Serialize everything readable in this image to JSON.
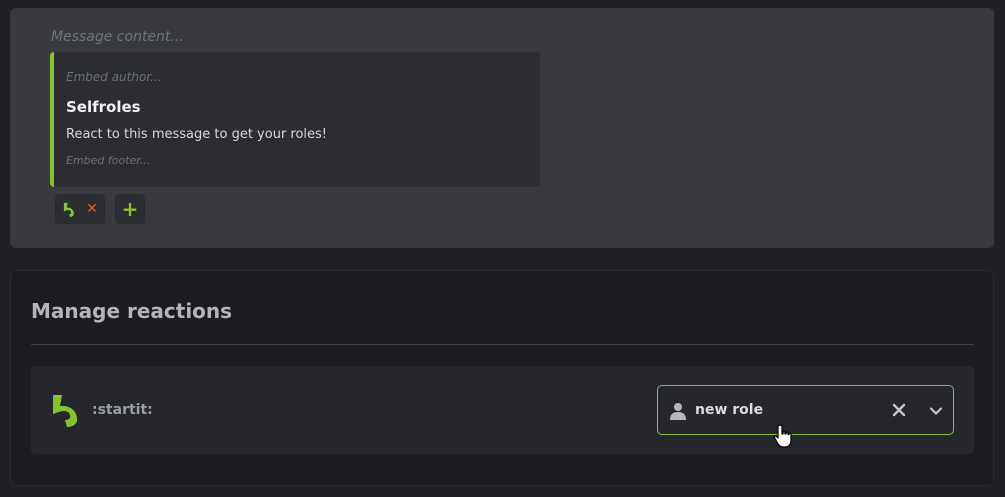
{
  "message": {
    "content_placeholder": "Message content...",
    "embed": {
      "accent_color": "#86c232",
      "author_placeholder": "Embed author...",
      "title": "Selfroles",
      "description": "React to this message to get your roles!",
      "footer_placeholder": "Embed footer..."
    },
    "reaction_chip": {
      "emoji_icon": "startit-emoji-icon",
      "remove_label": "✕"
    },
    "add_reaction_label": "+"
  },
  "manage": {
    "title": "Manage reactions",
    "rows": [
      {
        "emoji_icon": "startit-emoji-icon",
        "emoji_name": ":startit:",
        "role": {
          "icon": "user-icon",
          "value": "new role",
          "clear_icon": "close-icon",
          "dropdown_icon": "chevron-down-icon"
        }
      }
    ]
  },
  "colors": {
    "accent": "#86c232",
    "remove": "#e0602b",
    "page_bg": "#1f2024",
    "panel_bg": "#383a40"
  }
}
